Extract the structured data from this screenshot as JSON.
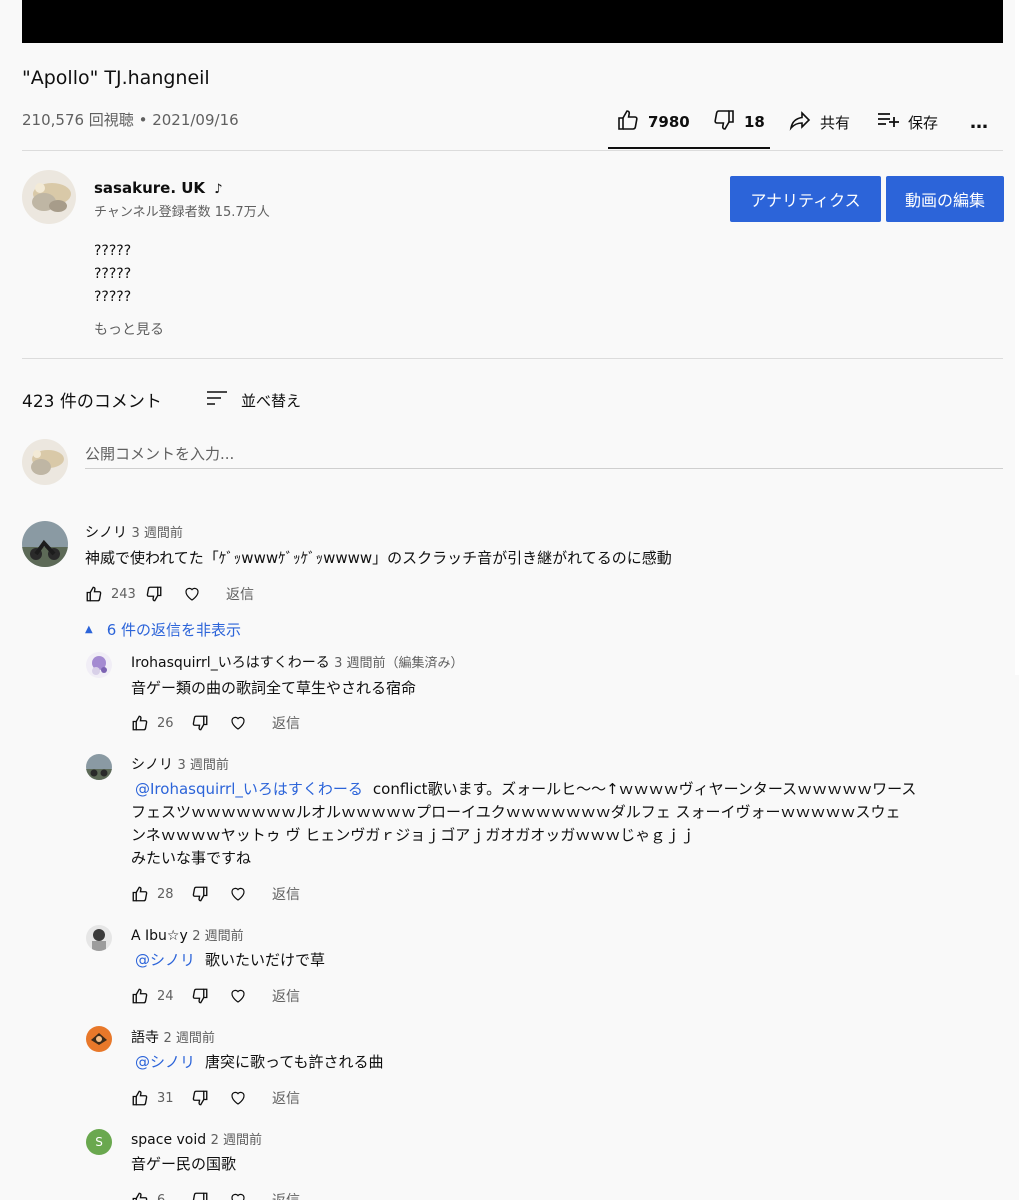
{
  "video": {
    "title": "\"Apollo\" TJ.hangneil",
    "views": "210,576 回視聴",
    "separator": " • ",
    "date": "2021/09/16"
  },
  "actions": {
    "likes": "7980",
    "dislikes": "18",
    "share": "共有",
    "save": "保存",
    "more": "…"
  },
  "channel": {
    "name": "sasakure. UK",
    "subscribers": "チャンネル登録者数 15.7万人",
    "analytics_button": "アナリティクス",
    "edit_button": "動画の編集"
  },
  "description": {
    "lines": [
      "?????",
      "?????",
      "?????"
    ],
    "more": "もっと見る"
  },
  "comments": {
    "count": "423 件のコメント",
    "sort_label": "並べ替え",
    "input_placeholder": "公開コメントを入力...",
    "reply_label": "返信",
    "top": {
      "author": "シノリ",
      "time": "3 週間前",
      "text": "神威で使われてた「ｹﾞｯwwwｹﾞｯｹﾞｯwwww」のスクラッチ音が引き継がれてるのに感動",
      "likes": "243",
      "hide_replies": "6 件の返信を非表示"
    },
    "replies": [
      {
        "author": "Irohasquirrl_いろはすくわーる",
        "time": "3 週間前（編集済み）",
        "mention": "",
        "text": "音ゲー類の曲の歌詞全て草生やされる宿命",
        "likes": "26"
      },
      {
        "author": "シノリ",
        "time": "3 週間前",
        "mention": "@Irohasquirrl_いろはすくわーる",
        "text_lines": [
          "conflict歌います。ズォールヒ〜〜↑ｗｗｗｗヴィヤーンタースｗｗｗｗｗワース",
          "フェスツｗｗｗｗｗｗｗルオルｗｗｗｗｗプローイユクｗｗｗｗｗｗｗダルフェ スォーイヴォーｗｗｗｗｗスウェ",
          "ンネｗｗｗｗヤットゥ ヴ ヒェンヴガｒジョｊゴアｊガオガオッガｗｗｗじゃｇｊｊ",
          "みたいな事ですね"
        ],
        "likes": "28"
      },
      {
        "author": "A Ibu☆y",
        "time": "2 週間前",
        "mention": "@シノリ",
        "text": "歌いたいだけで草",
        "likes": "24"
      },
      {
        "author": "語寺",
        "time": "2 週間前",
        "mention": "@シノリ",
        "text": "唐突に歌っても許される曲",
        "likes": "31"
      },
      {
        "author": "space void",
        "time": "2 週間前",
        "mention": "",
        "text": "音ゲー民の国歌",
        "likes": "6",
        "avatar_letter": "S"
      }
    ]
  },
  "colors": {
    "accent": "#2c64d9",
    "background": "#f9f9f9",
    "space_void_avatar": "#6aa84f",
    "katate_avatar": "#e8782a"
  }
}
